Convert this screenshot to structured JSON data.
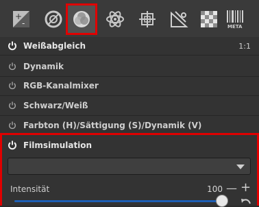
{
  "toolbar": {
    "tabs": [
      {
        "name": "exposure-tab",
        "icon": "exposure-icon"
      },
      {
        "name": "detail-tab",
        "icon": "detail-icon"
      },
      {
        "name": "color-tab",
        "icon": "color-icon",
        "active": true
      },
      {
        "name": "advanced-tab",
        "icon": "atom-icon"
      },
      {
        "name": "transform-tab",
        "icon": "transform-icon"
      },
      {
        "name": "raw-tab",
        "icon": "raw-icon"
      },
      {
        "name": "filter-tab",
        "icon": "checker-icon"
      },
      {
        "name": "meta-tab",
        "icon": "barcode-icon",
        "label": "META"
      }
    ]
  },
  "panel": {
    "items": [
      {
        "label": "Weißabgleich",
        "enabled": true,
        "extra": "1:1"
      },
      {
        "label": "Dynamik",
        "enabled": false
      },
      {
        "label": "RGB-Kanalmixer",
        "enabled": false
      },
      {
        "label": "Schwarz/Weiß",
        "enabled": false
      },
      {
        "label": "Farbton (H)/Sättigung (S)/Dynamik (V)",
        "enabled": false
      },
      {
        "label": "Filmsimulation",
        "enabled": true
      }
    ],
    "film": {
      "selected": "",
      "intensity_label": "Intensität",
      "intensity_value": "100",
      "minus": "—",
      "plus": "+"
    }
  },
  "colors": {
    "highlight": "#e00000",
    "slider": "#1d5fb5"
  }
}
